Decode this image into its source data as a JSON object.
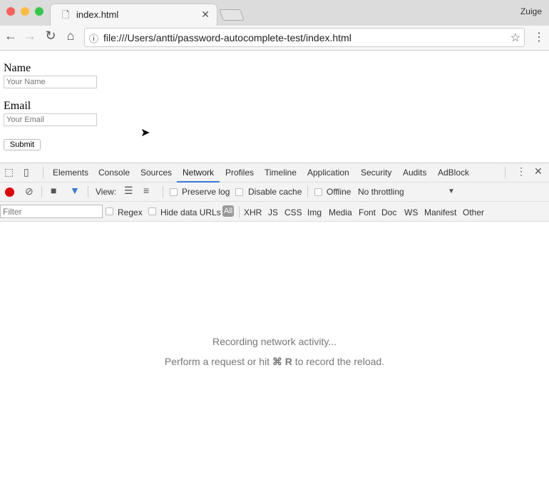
{
  "browser": {
    "tab_title": "index.html",
    "profile": "Zuige",
    "url": "file:///Users/antti/password-autocomplete-test/index.html"
  },
  "form": {
    "name_label": "Name",
    "name_placeholder": "Your Name",
    "email_label": "Email",
    "email_placeholder": "Your Email",
    "submit": "Submit"
  },
  "devtools": {
    "tabs": [
      "Elements",
      "Console",
      "Sources",
      "Network",
      "Profiles",
      "Timeline",
      "Application",
      "Security",
      "Audits",
      "AdBlock"
    ],
    "active_tab": "Network",
    "toolbar": {
      "view": "View:",
      "preserve_log": "Preserve log",
      "disable_cache": "Disable cache",
      "offline": "Offline",
      "throttling": "No throttling"
    },
    "filter": {
      "placeholder": "Filter",
      "regex": "Regex",
      "hide_data_urls": "Hide data URLs",
      "types": [
        "All",
        "XHR",
        "JS",
        "CSS",
        "Img",
        "Media",
        "Font",
        "Doc",
        "WS",
        "Manifest",
        "Other"
      ],
      "active_type": "All"
    },
    "empty": {
      "line1": "Recording network activity...",
      "line2_pre": "Perform a request or hit",
      "shortcut": "⌘ R",
      "line2_post": "to record the reload."
    },
    "colors": {
      "record": "#e00000",
      "accent": "#3879d9"
    }
  }
}
